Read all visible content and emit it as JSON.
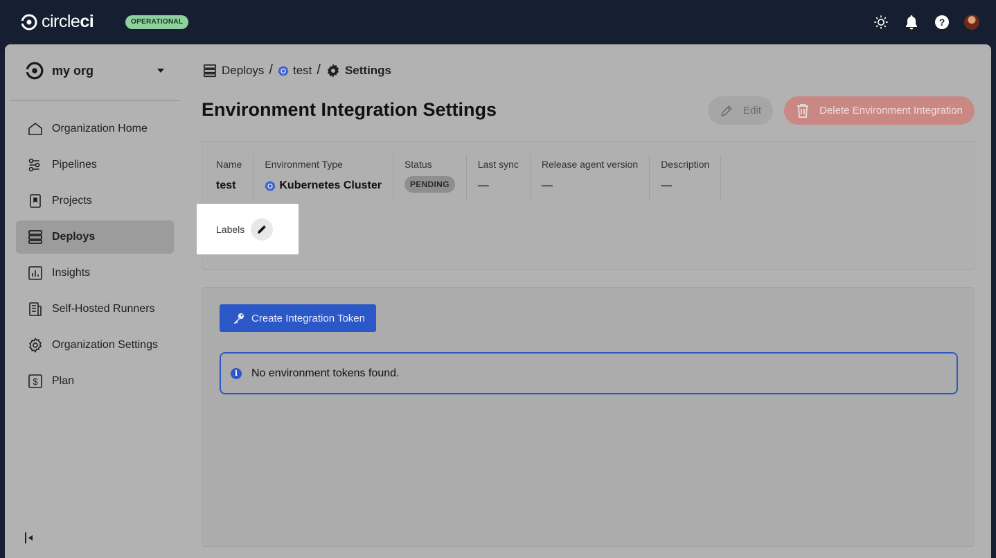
{
  "app": {
    "brand_light": "circle",
    "brand_bold": "ci",
    "status": "OPERATIONAL"
  },
  "topbar": {
    "icons": [
      "theme-sun-icon",
      "bell-icon",
      "help-icon",
      "avatar"
    ]
  },
  "sidebar": {
    "org_name": "my org",
    "items": [
      {
        "label": "Organization Home",
        "icon": "home-icon"
      },
      {
        "label": "Pipelines",
        "icon": "pipelines-icon"
      },
      {
        "label": "Projects",
        "icon": "projects-icon"
      },
      {
        "label": "Deploys",
        "icon": "deploys-icon",
        "active": true
      },
      {
        "label": "Insights",
        "icon": "insights-icon"
      },
      {
        "label": "Self-Hosted Runners",
        "icon": "runners-icon"
      },
      {
        "label": "Organization Settings",
        "icon": "gear-icon"
      },
      {
        "label": "Plan",
        "icon": "dollar-icon"
      }
    ]
  },
  "breadcrumb": {
    "deploys": "Deploys",
    "env": "test",
    "current": "Settings",
    "sep": "/"
  },
  "page": {
    "title": "Environment Integration Settings",
    "edit_label": "Edit",
    "delete_label": "Delete Environment Integration"
  },
  "details": {
    "fields": [
      {
        "label": "Name",
        "value": "test"
      },
      {
        "label": "Environment Type",
        "value": "Kubernetes Cluster"
      },
      {
        "label": "Status",
        "value": "PENDING"
      },
      {
        "label": "Last sync",
        "value": "—"
      },
      {
        "label": "Release agent version",
        "value": "—"
      },
      {
        "label": "Description",
        "value": "—"
      }
    ],
    "labels_label": "Labels"
  },
  "tokens": {
    "create_label": "Create Integration Token",
    "empty_message": "No environment tokens found."
  },
  "colors": {
    "primary": "#2c57c6",
    "danger": "#c98884",
    "operational": "#8fd19e"
  }
}
